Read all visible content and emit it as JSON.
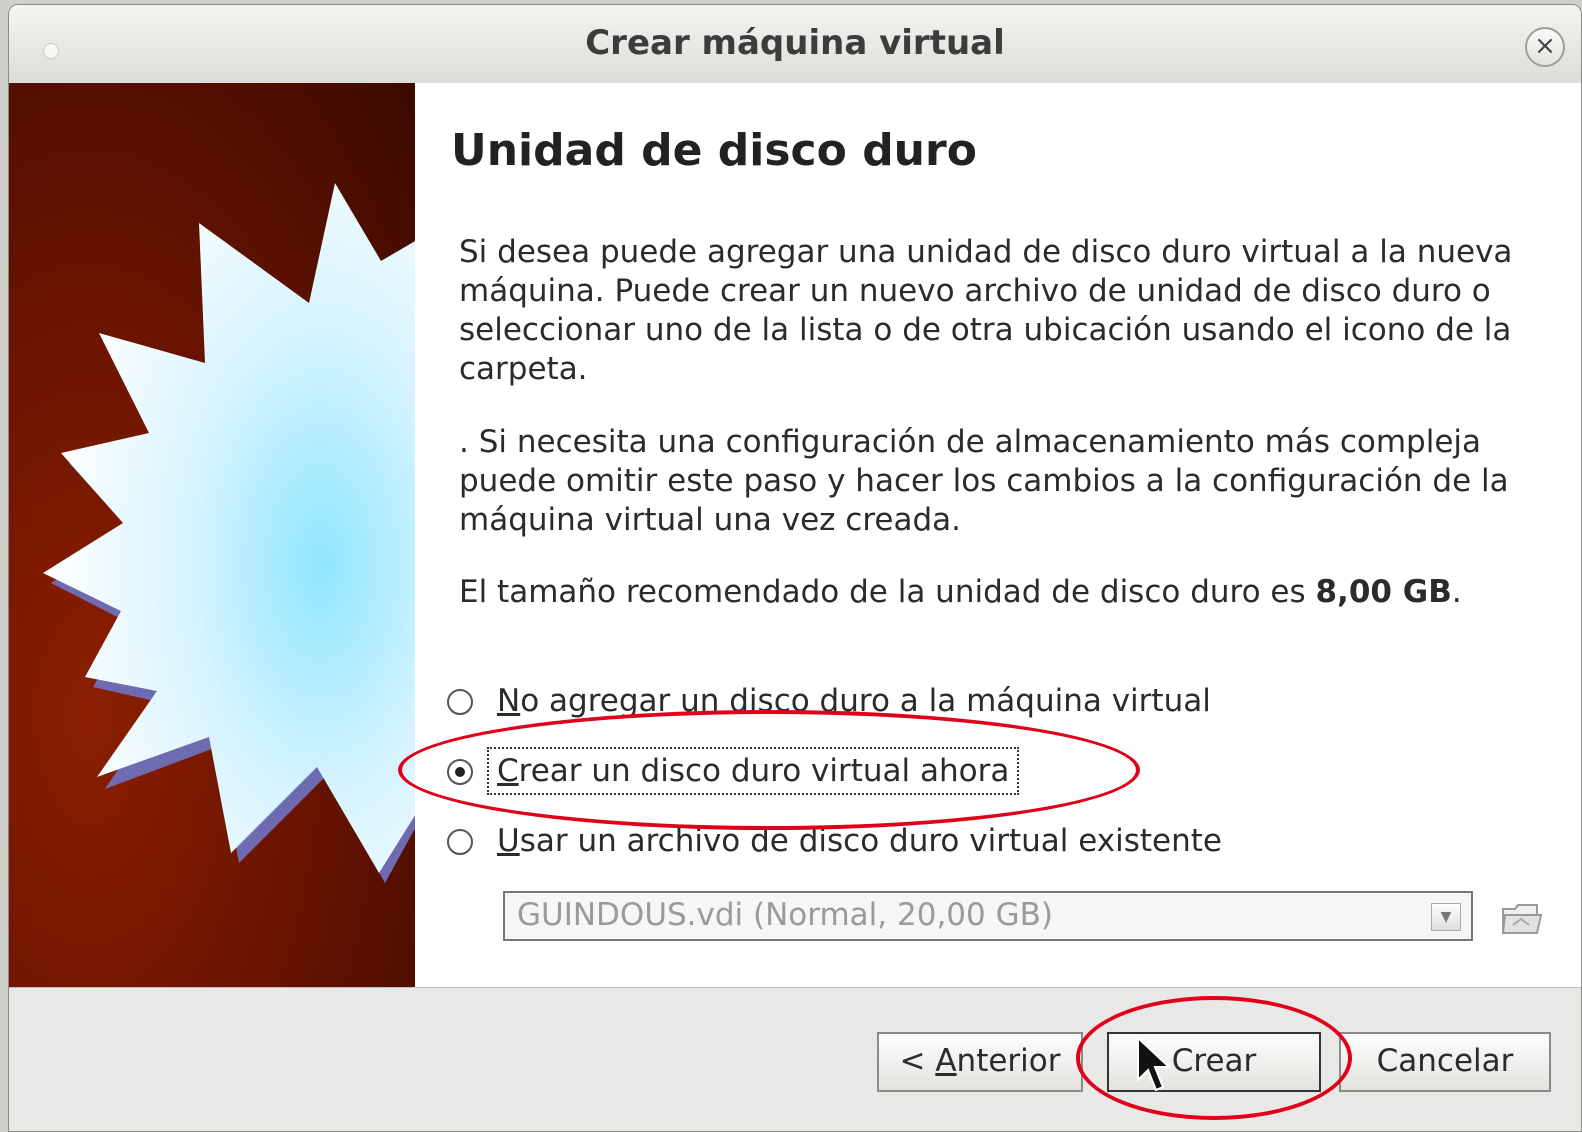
{
  "window": {
    "title": "Crear máquina virtual",
    "close_glyph": "×",
    "close_icon": "close-icon"
  },
  "content": {
    "heading": "Unidad de disco duro",
    "paragraph1": "Si desea puede agregar una unidad de disco duro virtual a la nueva máquina. Puede crear un nuevo archivo de unidad de disco duro o seleccionar uno de la lista o de otra ubicación usando el icono de la carpeta.",
    "paragraph2": ". Si necesita una configuración de almacenamiento más compleja puede omitir este paso y hacer los cambios a la configuración de la máquina virtual una vez creada.",
    "paragraph3_prefix": "El tamaño recomendado de la unidad de disco duro es ",
    "paragraph3_value": "8,00 GB",
    "paragraph3_suffix": "."
  },
  "options": [
    {
      "mnemonic": "N",
      "rest": "o agregar un disco duro a la máquina virtual",
      "selected": false
    },
    {
      "mnemonic": "C",
      "rest": "rear un disco duro virtual ahora",
      "selected": true
    },
    {
      "mnemonic": "U",
      "rest": "sar un archivo de disco duro virtual existente",
      "selected": false
    }
  ],
  "disk_select": {
    "value": "GUINDOUS.vdi (Normal, 20,00 GB)",
    "enabled": false,
    "arrow_icon": "dropdown-arrow-icon",
    "folder_icon": "folder-icon"
  },
  "buttons": {
    "prev_prefix": "< ",
    "prev_mnemonic": "A",
    "prev_rest": "nterior",
    "create": "Crear",
    "cancel": "Cancelar"
  },
  "colors": {
    "annotation": "#e0001a",
    "side_background": "#6a1400"
  }
}
